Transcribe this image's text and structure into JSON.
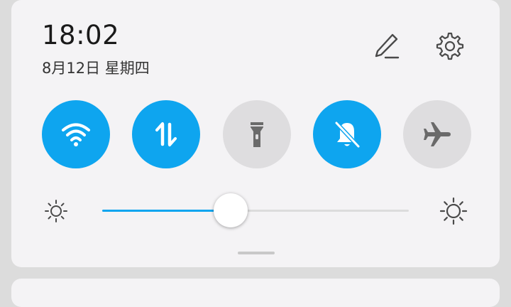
{
  "status": {
    "time": "18:02",
    "date": "8月12日 星期四"
  },
  "header_actions": [
    {
      "icon": "edit-icon"
    },
    {
      "icon": "gear-icon"
    }
  ],
  "toggles": [
    {
      "icon": "wifi-icon",
      "state": "on"
    },
    {
      "icon": "mobile-data-icon",
      "state": "on"
    },
    {
      "icon": "flashlight-icon",
      "state": "off"
    },
    {
      "icon": "bell-off-icon",
      "state": "on"
    },
    {
      "icon": "airplane-icon",
      "state": "off"
    }
  ],
  "brightness": {
    "level": 0.42,
    "min_icon": "sun-small-icon",
    "max_icon": "sun-large-icon"
  },
  "colors": {
    "accent": "#0ea5ef",
    "off": "#dedddf",
    "panel": "#f4f3f5",
    "background": "#dcdcdc"
  }
}
